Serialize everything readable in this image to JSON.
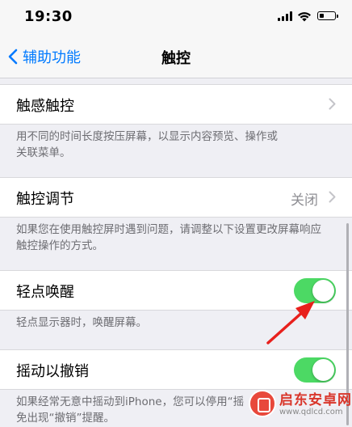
{
  "status_bar": {
    "time": "19:30"
  },
  "nav": {
    "back_label": "辅助功能",
    "title": "触控"
  },
  "sections": {
    "haptic_touch": {
      "label": "触感触控",
      "footer_line1": "用不同的时间长度按压屏幕，以显示内容预览、操作或",
      "footer_line2": "关联菜单。"
    },
    "touch_accommodations": {
      "label": "触控调节",
      "value": "关闭",
      "footer_line1": "如果您在使用触控屏时遇到问题，请调整以下设置更改屏幕响应",
      "footer_line2": "触控操作的方式。"
    },
    "tap_to_wake": {
      "label": "轻点唤醒",
      "on": true,
      "footer": "轻点显示器时，唤醒屏幕。"
    },
    "shake_to_undo": {
      "label": "摇动以撤销",
      "on": true,
      "footer_line1": "如果经常无意中摇动到iPhone，您可以停用“摇",
      "footer_line2": "免出现“撤销”提醒。"
    }
  },
  "watermark": {
    "title": "启东安卓网",
    "url": "www.qdlcd.com"
  },
  "colors": {
    "accent": "#007aff",
    "toggle_on": "#4cd964",
    "arrow": "#e8201c",
    "background": "#efeff4"
  }
}
